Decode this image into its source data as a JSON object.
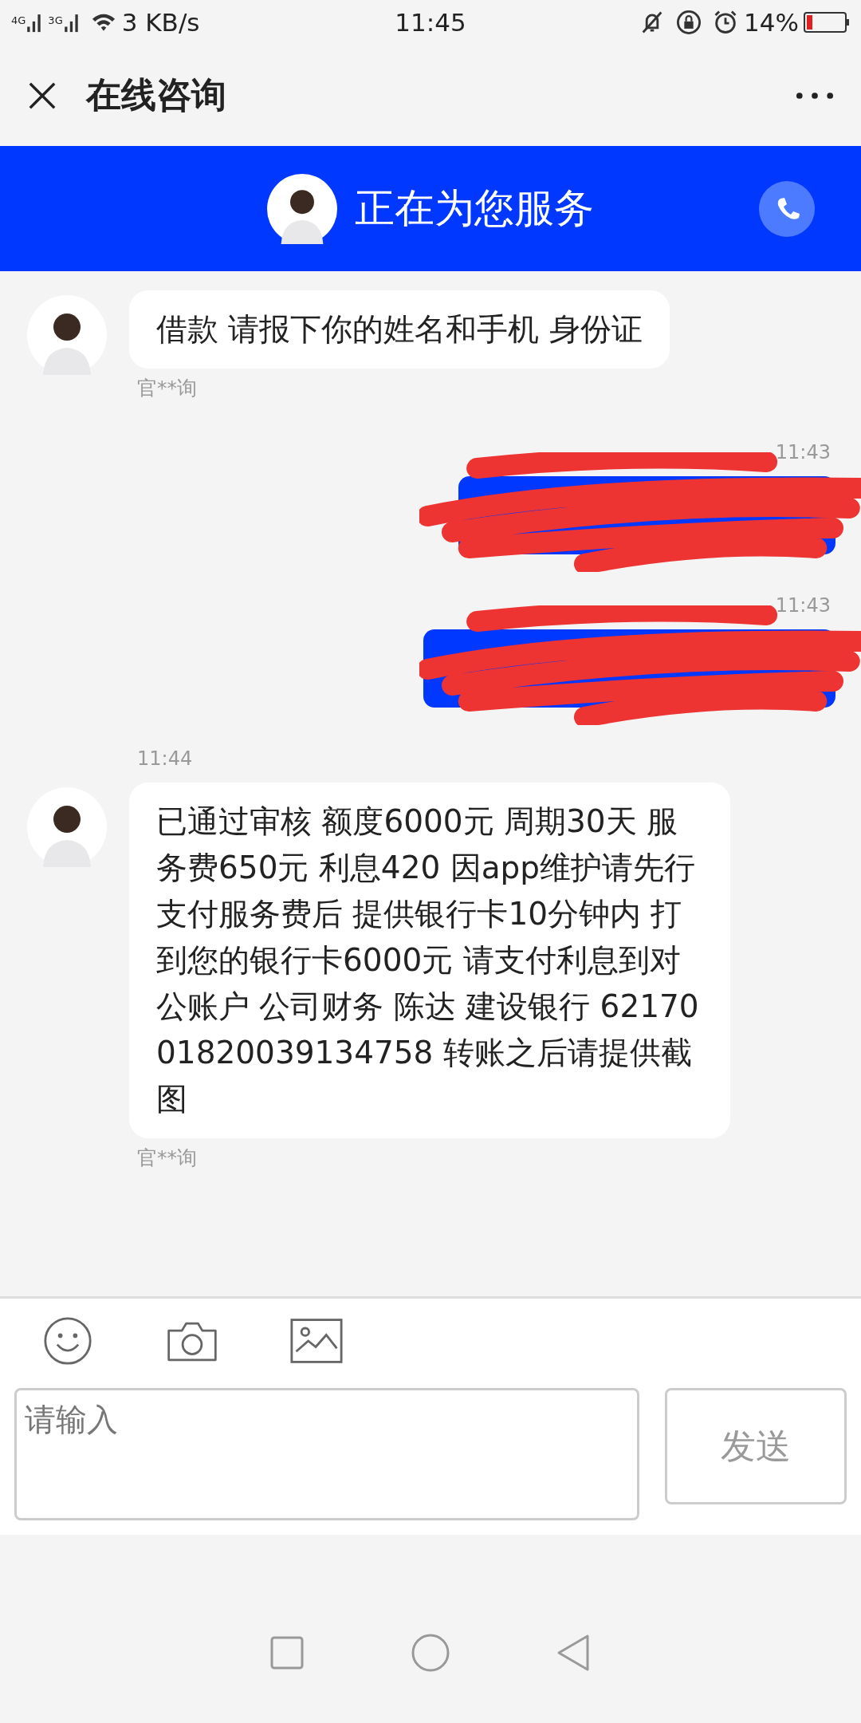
{
  "status_bar": {
    "network_1": "4G",
    "network_2": "3G",
    "speed": "3 KB/s",
    "time": "11:45",
    "battery": "14%"
  },
  "header": {
    "title": "在线咨询"
  },
  "banner": {
    "title": "正在为您服务"
  },
  "messages": [
    {
      "kind": "agent",
      "text": "借款 请报下你的姓名和手机 身份证",
      "sender": "官**询"
    },
    {
      "kind": "self",
      "time": "11:43"
    },
    {
      "kind": "self",
      "time": "11:43"
    },
    {
      "kind": "agent",
      "time": "11:44",
      "text": "已通过审核 额度6000元 周期30天 服务费650元 利息420 因app维护请先行支付服务费后 提供银行卡10分钟内 打到您的银行卡6000元 请支付利息到对公账户 公司财务 陈达   建设银行 6217001820039134758 转账之后请提供截图",
      "sender": "官**询"
    }
  ],
  "composer": {
    "placeholder": "请输入",
    "send": "发送"
  }
}
